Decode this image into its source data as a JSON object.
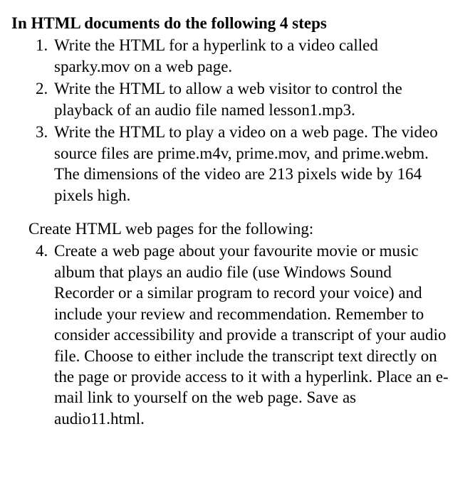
{
  "heading": "In HTML documents do the following 4 steps",
  "items_section1": [
    {
      "marker": "1.",
      "text": "Write the HTML for a hyperlink to a video called sparky.mov on a web page."
    },
    {
      "marker": "2.",
      "text": "Write the HTML to allow a web visitor to control the playback of an audio file named lesson1.mp3."
    },
    {
      "marker": "3.",
      "text": "Write the HTML to play a video on a web page. The video source files are prime.m4v, prime.mov, and prime.webm. The dimensions of the video are 213 pixels wide by 164 pixels high."
    }
  ],
  "section2_intro": "Create HTML web pages for the following:",
  "items_section2": [
    {
      "marker": "4.",
      "text": "Create a web page about your favourite movie or music album that plays an audio file (use Windows Sound Recorder or a similar program to record your voice) and include your review and recommendation. Remember to consider accessibility and provide a transcript of your audio file. Choose to either include the transcript text directly on the page or provide access to it with a hyperlink. Place an e-mail link to yourself on the web page. Save as audio11.html."
    }
  ]
}
